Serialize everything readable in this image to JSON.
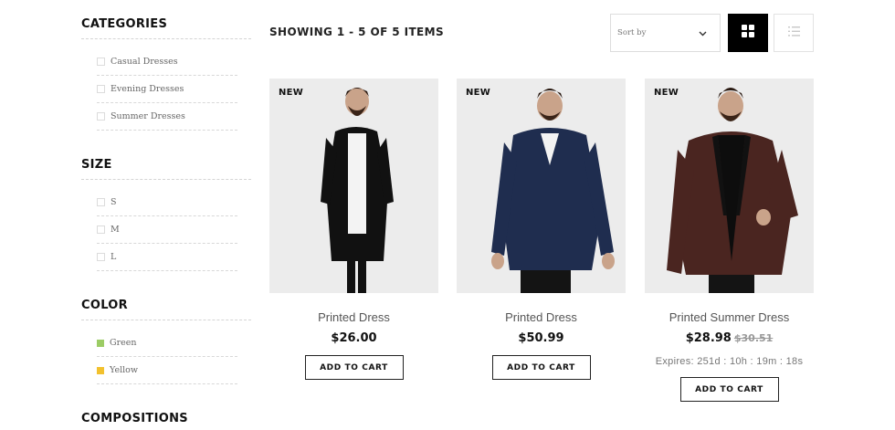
{
  "sidebar": {
    "categories": {
      "title": "CATEGORIES",
      "items": [
        {
          "label": "Casual Dresses"
        },
        {
          "label": "Evening Dresses"
        },
        {
          "label": "Summer Dresses"
        }
      ]
    },
    "size": {
      "title": "SIZE",
      "items": [
        {
          "label": "S"
        },
        {
          "label": "M"
        },
        {
          "label": "L"
        }
      ]
    },
    "color": {
      "title": "COLOR",
      "items": [
        {
          "label": "Green",
          "swatch": "#9ccc65"
        },
        {
          "label": "Yellow",
          "swatch": "#f2c12e"
        }
      ]
    },
    "compositions": {
      "title": "COMPOSITIONS"
    }
  },
  "toolbar": {
    "showing_text": "SHOWING 1 - 5 OF 5 ITEMS",
    "sort_label": "Sort by",
    "active_view": "grid"
  },
  "products": [
    {
      "badge": "NEW",
      "name": "Printed Dress",
      "price": "$26.00",
      "cart_label": "ADD TO CART",
      "garment_color": "#111111"
    },
    {
      "badge": "NEW",
      "name": "Printed Dress",
      "price": "$50.99",
      "cart_label": "ADD TO CART",
      "garment_color": "#1f2d4f"
    },
    {
      "badge": "NEW",
      "name": "Printed Summer Dress",
      "price": "$28.98",
      "old_price": "$30.51",
      "expires": "Expires:  251d  :  10h  :  19m  :  18s",
      "cart_label": "ADD TO CART",
      "garment_color": "#4a2520"
    }
  ]
}
